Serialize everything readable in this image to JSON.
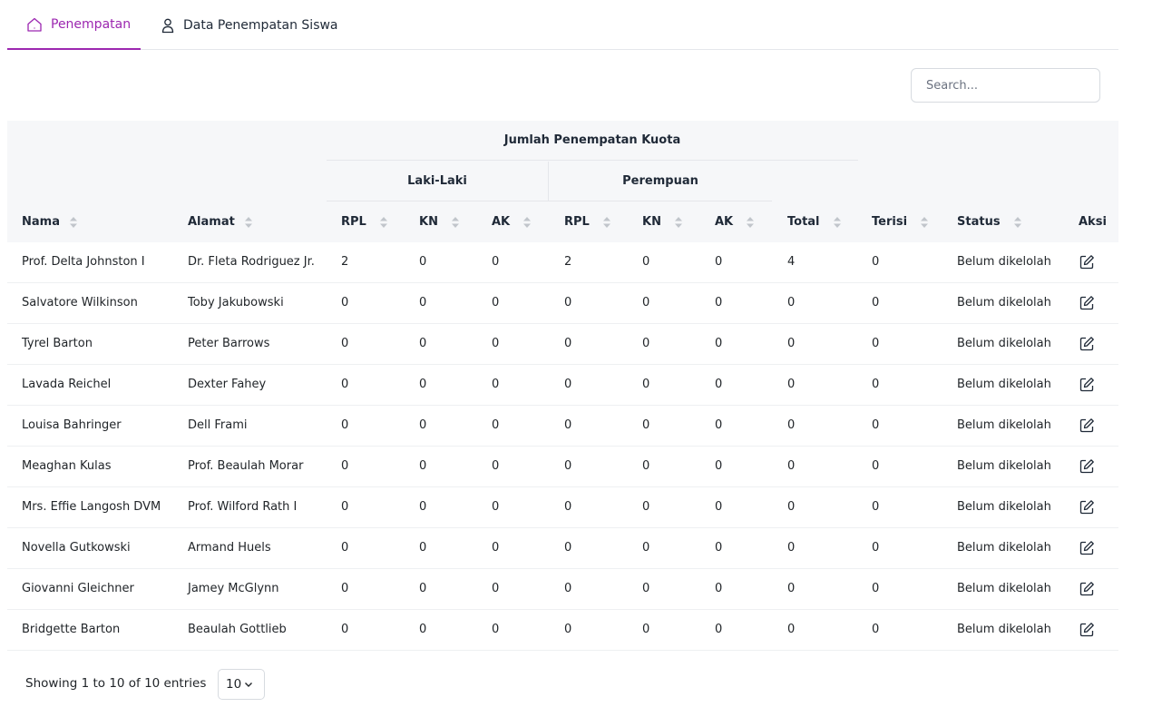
{
  "tabs": [
    {
      "label": "Penempatan",
      "icon": "home-icon",
      "active": true
    },
    {
      "label": "Data Penempatan Siswa",
      "icon": "user-icon",
      "active": false
    }
  ],
  "search": {
    "placeholder": "Search..."
  },
  "table": {
    "group_header": "Jumlah Penempatan Kuota",
    "subgroups": [
      "Laki-Laki",
      "Perempuan"
    ],
    "columns": [
      "Nama",
      "Alamat",
      "RPL",
      "KN",
      "AK",
      "RPL",
      "KN",
      "AK",
      "Total",
      "Terisi",
      "Status",
      "Aksi"
    ],
    "rows": [
      {
        "nama": "Prof. Delta Johnston I",
        "alamat": "Dr. Fleta Rodriguez Jr.",
        "l_rpl": "2",
        "l_kn": "0",
        "l_ak": "0",
        "p_rpl": "2",
        "p_kn": "0",
        "p_ak": "0",
        "total": "4",
        "terisi": "0",
        "status": "Belum dikelolah"
      },
      {
        "nama": "Salvatore Wilkinson",
        "alamat": "Toby Jakubowski",
        "l_rpl": "0",
        "l_kn": "0",
        "l_ak": "0",
        "p_rpl": "0",
        "p_kn": "0",
        "p_ak": "0",
        "total": "0",
        "terisi": "0",
        "status": "Belum dikelolah"
      },
      {
        "nama": "Tyrel Barton",
        "alamat": "Peter Barrows",
        "l_rpl": "0",
        "l_kn": "0",
        "l_ak": "0",
        "p_rpl": "0",
        "p_kn": "0",
        "p_ak": "0",
        "total": "0",
        "terisi": "0",
        "status": "Belum dikelolah"
      },
      {
        "nama": "Lavada Reichel",
        "alamat": "Dexter Fahey",
        "l_rpl": "0",
        "l_kn": "0",
        "l_ak": "0",
        "p_rpl": "0",
        "p_kn": "0",
        "p_ak": "0",
        "total": "0",
        "terisi": "0",
        "status": "Belum dikelolah"
      },
      {
        "nama": "Louisa Bahringer",
        "alamat": "Dell Frami",
        "l_rpl": "0",
        "l_kn": "0",
        "l_ak": "0",
        "p_rpl": "0",
        "p_kn": "0",
        "p_ak": "0",
        "total": "0",
        "terisi": "0",
        "status": "Belum dikelolah"
      },
      {
        "nama": "Meaghan Kulas",
        "alamat": "Prof. Beaulah Morar",
        "l_rpl": "0",
        "l_kn": "0",
        "l_ak": "0",
        "p_rpl": "0",
        "p_kn": "0",
        "p_ak": "0",
        "total": "0",
        "terisi": "0",
        "status": "Belum dikelolah"
      },
      {
        "nama": "Mrs. Effie Langosh DVM",
        "alamat": "Prof. Wilford Rath I",
        "l_rpl": "0",
        "l_kn": "0",
        "l_ak": "0",
        "p_rpl": "0",
        "p_kn": "0",
        "p_ak": "0",
        "total": "0",
        "terisi": "0",
        "status": "Belum dikelolah"
      },
      {
        "nama": "Novella Gutkowski",
        "alamat": "Armand Huels",
        "l_rpl": "0",
        "l_kn": "0",
        "l_ak": "0",
        "p_rpl": "0",
        "p_kn": "0",
        "p_ak": "0",
        "total": "0",
        "terisi": "0",
        "status": "Belum dikelolah"
      },
      {
        "nama": "Giovanni Gleichner",
        "alamat": "Jamey McGlynn",
        "l_rpl": "0",
        "l_kn": "0",
        "l_ak": "0",
        "p_rpl": "0",
        "p_kn": "0",
        "p_ak": "0",
        "total": "0",
        "terisi": "0",
        "status": "Belum dikelolah"
      },
      {
        "nama": "Bridgette Barton",
        "alamat": "Beaulah Gottlieb",
        "l_rpl": "0",
        "l_kn": "0",
        "l_ak": "0",
        "p_rpl": "0",
        "p_kn": "0",
        "p_ak": "0",
        "total": "0",
        "terisi": "0",
        "status": "Belum dikelolah"
      }
    ],
    "action_icon": "edit-icon"
  },
  "footer": {
    "showing": "Showing 1 to 10 of 10 entries",
    "page_size": "10"
  },
  "colors": {
    "accent": "#9c27b0",
    "header_bg": "#f6f7f9",
    "text": "#212529"
  }
}
